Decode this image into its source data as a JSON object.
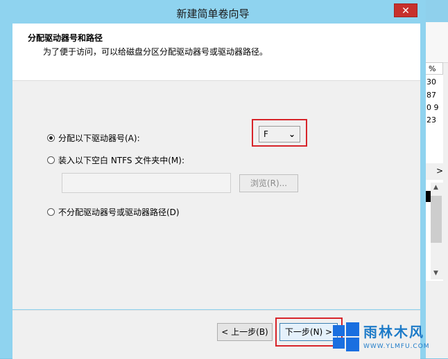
{
  "dialog": {
    "title": "新建简单卷向导",
    "close_glyph": "✕",
    "header": {
      "title": "分配驱动器号和路径",
      "subtitle": "为了便于访问，可以给磁盘分区分配驱动器号或驱动器路径。"
    },
    "options": {
      "assign_letter": "分配以下驱动器号(A):",
      "mount_folder": "装入以下空白 NTFS 文件夹中(M):",
      "no_assign": "不分配驱动器号或驱动器路径(D)"
    },
    "drive_letter": {
      "value": "F",
      "arrow": "⌄"
    },
    "path_input": {
      "value": ""
    },
    "browse_label": "浏览(R)...",
    "buttons": {
      "back": "< 上一步(B)",
      "next": "下一步(N) >"
    },
    "selected_option": "assign_letter"
  },
  "background_window": {
    "column_header": "%",
    "values": [
      "30",
      "87",
      "0 9",
      "23"
    ],
    "scroll_glyph": ">"
  },
  "watermark": {
    "text": "雨林木风",
    "url": "WWW.YLMFU.COM"
  },
  "colors": {
    "titlebar": "#8fd3ef",
    "close": "#c7302c",
    "highlight": "#d7242a"
  }
}
